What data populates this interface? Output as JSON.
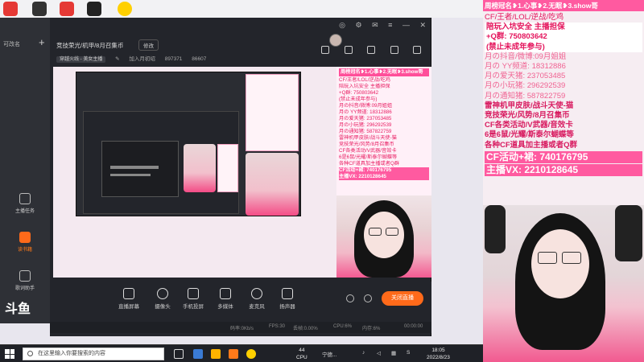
{
  "host": {
    "side_title": "可改名",
    "add": "+",
    "nav": [
      {
        "label": "主播任务"
      },
      {
        "label": "读书籍"
      },
      {
        "label": "歌词助手"
      }
    ],
    "logo_text": "斗鱼"
  },
  "window": {
    "title": "竞技荣光/机甲/8月召集币",
    "edit_label": "修改",
    "category": "穿越火线 - 美女主播",
    "category_edit": "✎",
    "subscribe": "加入月初绍",
    "uid": "897371",
    "viewers": "86607"
  },
  "toolbar": {
    "items": [
      {
        "label": "直播屏幕",
        "icon": "screen-icon"
      },
      {
        "label": "摄像头",
        "icon": "camera-icon"
      },
      {
        "label": "手机投屏",
        "icon": "phone-icon"
      },
      {
        "label": "多媒体",
        "icon": "media-icon"
      },
      {
        "label": "麦克风",
        "icon": "mic-icon"
      },
      {
        "label": "扬声器",
        "icon": "speaker-icon"
      }
    ],
    "live_label": "关闭直播"
  },
  "status": {
    "rate": "码率:0Kb/s",
    "fps": "FPS:30",
    "loss": "丢帧:0.00%",
    "cpu": "CPU:6%",
    "mem": "内存:6%",
    "time": "00:00:00"
  },
  "overlay": {
    "head": "周榜冠名❥1.心事❥2.无眠❥3.show哥",
    "lines": [
      {
        "text": "CF/王者/LOL/逆战/吃鸡",
        "cls": ""
      },
      {
        "text": "陪玩入坑安全 主播担保",
        "cls": "hi"
      },
      {
        "text": "+Q群: 750803642",
        "cls": "hi"
      },
      {
        "text": "(禁止未成年参与)",
        "cls": "hi"
      },
      {
        "text": "月の抖音/微博:09月姐姐",
        "cls": "pink"
      },
      {
        "text": "月の YY频道: 18312886",
        "cls": "pink"
      },
      {
        "text": "月の爱天猪: 237053485",
        "cls": "pink"
      },
      {
        "text": "月の小玩猪: 296292539",
        "cls": "pink"
      },
      {
        "text": "月の通知猪: 587822759",
        "cls": "pink"
      },
      {
        "text": "雷神机甲皮肤/战斗天使-猫",
        "cls": "purple"
      },
      {
        "text": "竞技荣光/风势/8月召集币",
        "cls": "purple"
      },
      {
        "text": "CF各类活动/V武器/音效卡",
        "cls": "purple"
      },
      {
        "text": "6是6鼠/光耀/斯泰尔蝴蝶等",
        "cls": "purple"
      },
      {
        "text": "各种CF道具加主播或者Q群",
        "cls": "purple"
      }
    ],
    "activity": "CF活动+裙: 740176795",
    "vx": "主播VX: 2210128645"
  },
  "taskbar": {
    "search_placeholder": "在这里输入你要搜索的内容",
    "cpu_value": "44",
    "cpu_label": "CPU",
    "ime": "宁德...",
    "time": "18:05",
    "date": "2022/8/23"
  }
}
